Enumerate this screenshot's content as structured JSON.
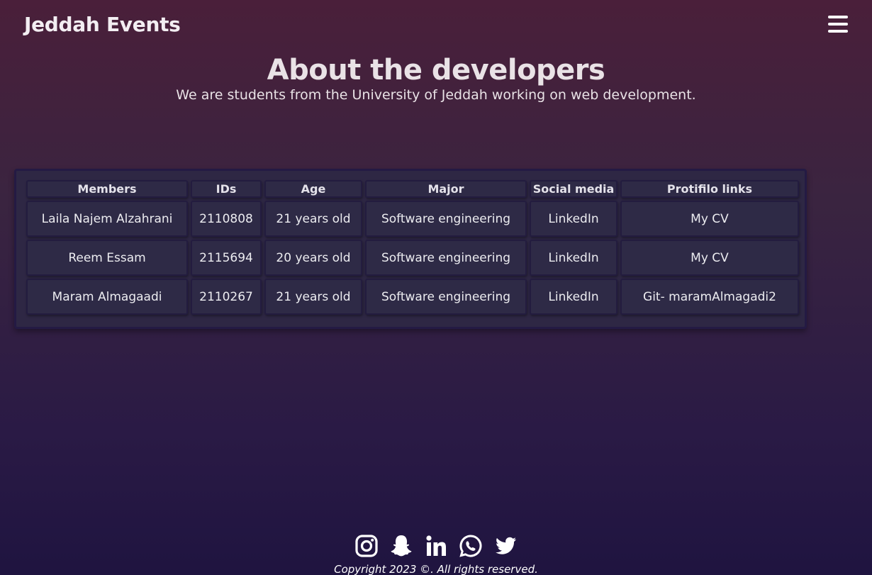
{
  "header": {
    "brand": "Jeddah Events",
    "menu_icon": "hamburger-menu-icon"
  },
  "main": {
    "title": "About the developers",
    "subtitle": "We are students from the University of Jeddah working on web development."
  },
  "table": {
    "headers": [
      "Members",
      "IDs",
      "Age",
      "Major",
      "Social media",
      "Protifilo links"
    ],
    "rows": [
      {
        "member": "Laila Najem Alzahrani",
        "id": "2110808",
        "age": "21 years old",
        "major": "Software engineering",
        "social": "LinkedIn",
        "portfolio": "My CV"
      },
      {
        "member": "Reem Essam",
        "id": "2115694",
        "age": "20 years old",
        "major": "Software engineering",
        "social": "LinkedIn",
        "portfolio": "My CV"
      },
      {
        "member": "Maram Almagaadi",
        "id": "2110267",
        "age": "21 years old",
        "major": "Software engineering",
        "social": "LinkedIn",
        "portfolio": "Git- maramAlmagadi2"
      }
    ]
  },
  "footer": {
    "social_icons": [
      "instagram-icon",
      "snapchat-icon",
      "linkedin-icon",
      "whatsapp-icon",
      "twitter-icon"
    ],
    "copyright": "Copyright 2023 ©. All rights reserved."
  },
  "colors": {
    "background_top": "#4a1f3a",
    "background_bottom": "#1f1440",
    "cell_background": "#2e2a46",
    "cell_border": "#231c3f",
    "text": "#ececf0"
  }
}
